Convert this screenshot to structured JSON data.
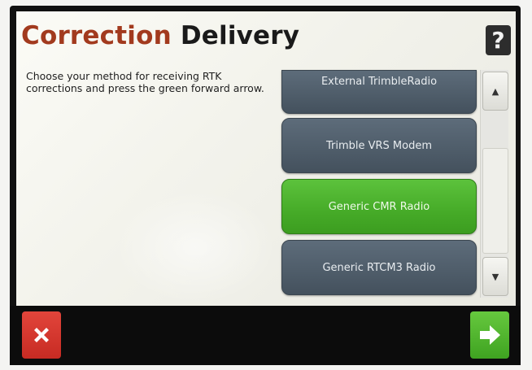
{
  "header": {
    "title_accent": "Correction",
    "title_rest": " Delivery",
    "help_label": "?"
  },
  "instructions": "Choose your method for receiving RTK corrections and press the green forward arrow.",
  "options": [
    {
      "label": "External TrimbleRadio",
      "selected": false
    },
    {
      "label": "Trimble VRS Modem",
      "selected": false
    },
    {
      "label": "Generic CMR Radio",
      "selected": true
    },
    {
      "label": "Generic RTCM3 Radio",
      "selected": false
    }
  ],
  "scrollbar": {
    "up_glyph": "▲",
    "down_glyph": "▼"
  },
  "footer": {
    "cancel_icon": "close-icon",
    "forward_icon": "arrow-right-icon"
  },
  "colors": {
    "accent_title": "#a23a1e",
    "option_default": "#4e5c69",
    "option_selected": "#46ab28",
    "cancel": "#c72b23",
    "forward": "#3fa321"
  }
}
